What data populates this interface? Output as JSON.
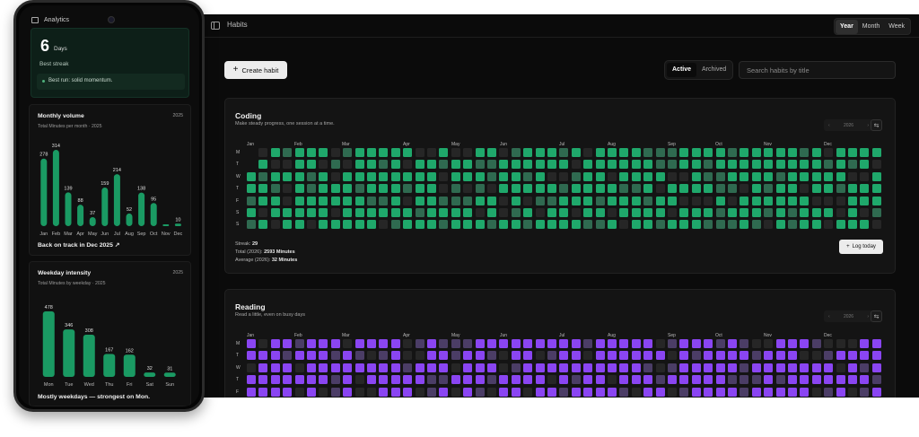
{
  "desktop": {
    "page_title": "Habits",
    "view_options": [
      "Year",
      "Month",
      "Week"
    ],
    "view_selected": "Year",
    "create_button": "Create habit",
    "filter_tabs": [
      "Active",
      "Archived"
    ],
    "filter_selected": "Active",
    "search_placeholder": "Search habits by title",
    "months": [
      "Jan",
      "Feb",
      "Mar",
      "Apr",
      "May",
      "Jun",
      "Jul",
      "Aug",
      "Sep",
      "Oct",
      "Nov",
      "Dec"
    ],
    "weekday_rows": [
      "M",
      "T",
      "W",
      "T",
      "F",
      "S",
      "S"
    ],
    "habits": [
      {
        "title": "Coding",
        "subtitle": "Make steady progress, one session at a time.",
        "year": "2026",
        "color": "#1fa86b",
        "dim_color": "#2f6a50",
        "streak_label": "Streak:",
        "streak_value": "29",
        "total_label": "Total (2026):",
        "total_value": "2593 Minutes",
        "average_label": "Average (2026):",
        "average_value": "32 Minutes",
        "log_button": "Log today"
      },
      {
        "title": "Reading",
        "subtitle": "Read a little, even on busy days",
        "year": "2026",
        "color": "#8a45f2",
        "dim_color": "#4b3d66"
      }
    ]
  },
  "phone": {
    "app_title": "Analytics",
    "streak": {
      "value": "6",
      "unit": "Days",
      "label": "Best streak",
      "note": "Best run: solid momentum."
    },
    "monthly": {
      "title": "Monthly volume",
      "subtitle": "Total Minutes per month · 2025",
      "year": "2025",
      "footer": "Back on track in Dec 2025"
    },
    "weekday": {
      "title": "Weekday intensity",
      "subtitle": "Total Minutes by weekday · 2025",
      "year": "2025",
      "footer": "Mostly weekdays — strongest on Mon."
    },
    "accent": "#1a9a63"
  },
  "chart_data": [
    {
      "type": "bar",
      "title": "Monthly volume",
      "categories": [
        "Jan",
        "Feb",
        "Mar",
        "Apr",
        "May",
        "Jun",
        "Jul",
        "Aug",
        "Sep",
        "Oct",
        "Nov",
        "Dec"
      ],
      "values": [
        278,
        314,
        139,
        88,
        37,
        159,
        214,
        52,
        138,
        95,
        0,
        10
      ],
      "labels": [
        "278",
        "314",
        "139",
        "88",
        "37",
        "159",
        "214",
        "52",
        "138",
        "95",
        "",
        "10"
      ],
      "ylim": [
        0,
        314
      ]
    },
    {
      "type": "bar",
      "title": "Weekday intensity",
      "categories": [
        "Mon",
        "Tue",
        "Wed",
        "Thu",
        "Fri",
        "Sat",
        "Sun"
      ],
      "values": [
        478,
        346,
        308,
        167,
        162,
        32,
        31
      ],
      "labels": [
        "478",
        "346",
        "308",
        "167",
        "162",
        "32",
        "31"
      ],
      "ylim": [
        0,
        478
      ]
    }
  ]
}
